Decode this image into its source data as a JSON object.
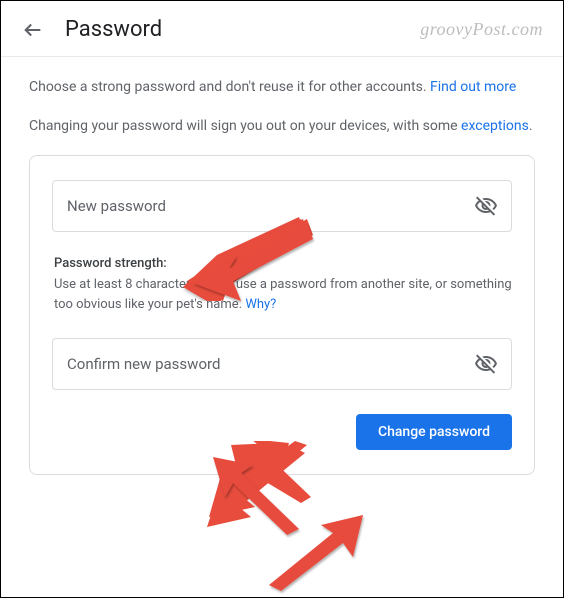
{
  "header": {
    "title": "Password"
  },
  "watermark": "groovyPost.com",
  "intro": {
    "text1_a": "Choose a strong password and don't reuse it for other accounts. ",
    "link1": "Find out more",
    "text2_a": "Changing your password will sign you out on your devices, with some ",
    "link2": "exceptions",
    "text2_b": "."
  },
  "form": {
    "new_password_placeholder": "New password",
    "confirm_password_placeholder": "Confirm new password",
    "strength_title": "Password strength:",
    "strength_text_a": "Use at least 8 characters. Don't use a password from another site, or something too obvious like your pet's name. ",
    "strength_link": "Why?",
    "change_button": "Change password"
  }
}
